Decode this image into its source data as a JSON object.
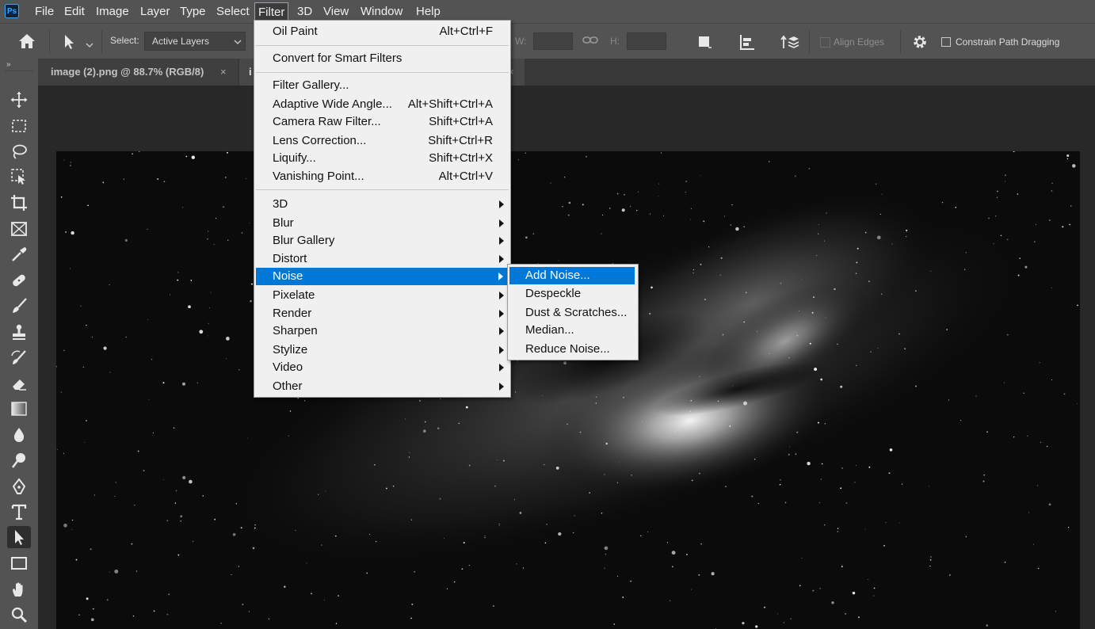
{
  "app": {
    "logo_text": "Ps"
  },
  "menubar": {
    "items": [
      "File",
      "Edit",
      "Image",
      "Layer",
      "Type",
      "Select",
      "Filter",
      "3D",
      "View",
      "Window",
      "Help"
    ],
    "active": "Filter"
  },
  "options": {
    "select_label": "Select:",
    "select_value": "Active Layers",
    "w_label": "W:",
    "h_label": "H:",
    "align_edges_label": "Align Edges",
    "constrain_label": "Constrain Path Dragging"
  },
  "tabs": [
    {
      "title": "image (2).png @ 88.7% (RGB/8)",
      "close": "×"
    },
    {
      "title": "i",
      "close": "×"
    }
  ],
  "tools": [
    "move-icon",
    "marquee-icon",
    "lasso-icon",
    "object-select-icon",
    "crop-icon",
    "frame-icon",
    "eyedropper-icon",
    "healing-brush-icon",
    "brush-icon",
    "stamp-icon",
    "history-brush-icon",
    "eraser-icon",
    "gradient-icon",
    "blur-icon",
    "dodge-icon",
    "pen-icon",
    "type-icon",
    "path-select-icon",
    "rectangle-icon",
    "hand-icon",
    "zoom-icon"
  ],
  "filter_menu": {
    "items": [
      {
        "label": "Oil Paint",
        "shortcut": "Alt+Ctrl+F"
      },
      {
        "label": "Convert for Smart Filters",
        "shortcut": ""
      },
      {
        "label": "Filter Gallery...",
        "shortcut": ""
      },
      {
        "label": "Adaptive Wide Angle...",
        "shortcut": "Alt+Shift+Ctrl+A"
      },
      {
        "label": "Camera Raw Filter...",
        "shortcut": "Shift+Ctrl+A"
      },
      {
        "label": "Lens Correction...",
        "shortcut": "Shift+Ctrl+R"
      },
      {
        "label": "Liquify...",
        "shortcut": "Shift+Ctrl+X"
      },
      {
        "label": "Vanishing Point...",
        "shortcut": "Alt+Ctrl+V"
      },
      {
        "label": "3D",
        "shortcut": ""
      },
      {
        "label": "Blur",
        "shortcut": ""
      },
      {
        "label": "Blur Gallery",
        "shortcut": ""
      },
      {
        "label": "Distort",
        "shortcut": ""
      },
      {
        "label": "Noise",
        "shortcut": ""
      },
      {
        "label": "Pixelate",
        "shortcut": ""
      },
      {
        "label": "Render",
        "shortcut": ""
      },
      {
        "label": "Sharpen",
        "shortcut": ""
      },
      {
        "label": "Stylize",
        "shortcut": ""
      },
      {
        "label": "Video",
        "shortcut": ""
      },
      {
        "label": "Other",
        "shortcut": ""
      }
    ],
    "highlighted": "Noise"
  },
  "noise_submenu": {
    "items": [
      "Add Noise...",
      "Despeckle",
      "Dust & Scratches...",
      "Median...",
      "Reduce Noise..."
    ],
    "highlighted": "Add Noise..."
  },
  "colors": {
    "highlight": "#0078d7",
    "panel": "#535353",
    "menu_bg": "#f0f0f0"
  }
}
